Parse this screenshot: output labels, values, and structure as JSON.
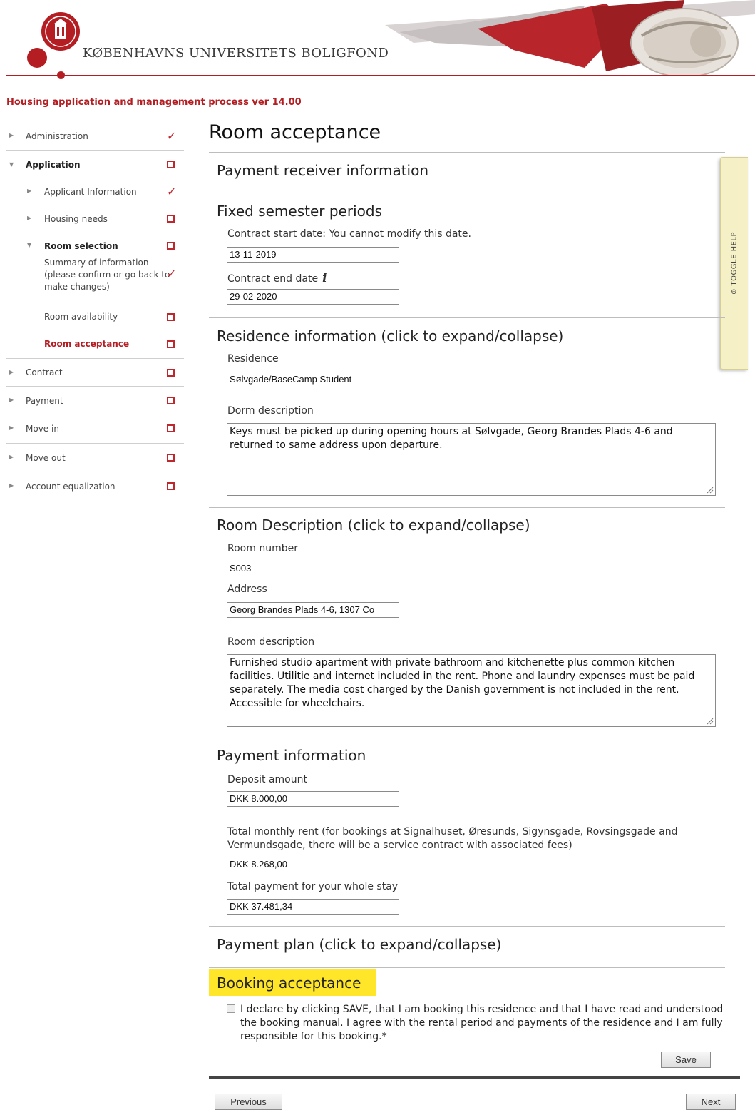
{
  "header": {
    "university_name": "KØBENHAVNS UNIVERSITETS BOLIGFOND",
    "process_title": "Housing application and management process ver 14.00"
  },
  "sidebar": {
    "items": [
      {
        "label": "Administration",
        "status": "check"
      },
      {
        "label": "Application",
        "status": "box"
      },
      {
        "label": "Applicant Information",
        "status": "check"
      },
      {
        "label": "Housing needs",
        "status": "box"
      },
      {
        "label": "Room selection",
        "status": "box"
      },
      {
        "label": "Summary of information (please confirm or go back to make changes)",
        "status": "check"
      },
      {
        "label": "Room availability",
        "status": "box"
      },
      {
        "label": "Room acceptance",
        "status": "box"
      },
      {
        "label": "Contract",
        "status": "box"
      },
      {
        "label": "Payment",
        "status": "box"
      },
      {
        "label": "Move in",
        "status": "box"
      },
      {
        "label": "Move out",
        "status": "box"
      },
      {
        "label": "Account equalization",
        "status": "box"
      }
    ]
  },
  "main": {
    "page_title": "Room acceptance",
    "payment_receiver_title": "Payment receiver information",
    "fixed_periods_title": "Fixed semester periods",
    "contract_start_label": "Contract start date: You cannot modify this date.",
    "contract_start_value": "13-11-2019",
    "contract_end_label": "Contract end date",
    "contract_end_value": "29-02-2020",
    "residence_title": "Residence information (click to expand/collapse)",
    "residence_label": "Residence",
    "residence_value": "Sølvgade/BaseCamp Student",
    "dorm_desc_label": "Dorm description",
    "dorm_desc_value": "Keys must be picked up during opening hours at Sølvgade, Georg Brandes Plads 4-6 and returned to same address upon departure.",
    "room_desc_title": "Room Description (click to expand/collapse)",
    "room_number_label": "Room number",
    "room_number_value": "S003",
    "address_label": "Address",
    "address_value": "Georg Brandes Plads 4-6, 1307 Co",
    "room_description_label": "Room description",
    "room_description_value": "Furnished studio apartment with private bathroom and kitchenette plus common kitchen facilities. Utilitie and internet included in the rent. Phone and laundry expenses must be paid separately. The media cost charged by the Danish government is not included in the rent. Accessible for wheelchairs.",
    "payment_info_title": "Payment information",
    "deposit_label": "Deposit amount",
    "deposit_value": "DKK 8.000,00",
    "monthly_rent_label": "Total monthly rent (for bookings at Signalhuset, Øresunds, Sigynsgade, Rovsingsgade and Vermundsgade, there will be a service contract with associated fees)",
    "monthly_rent_value": "DKK 8.268,00",
    "total_payment_label": "Total payment for your whole stay",
    "total_payment_value": "DKK 37.481,34",
    "payment_plan_title": "Payment plan (click to expand/collapse)",
    "booking_acceptance_title": "Booking acceptance",
    "declaration_text": "I declare by clicking SAVE, that I am booking this residence and that I have read and understood the booking manual. I agree with the rental period and payments of the residence and I am fully responsible for this booking.*",
    "save_label": "Save",
    "previous_label": "Previous",
    "next_label": "Next"
  },
  "toggle_help_label": "⊕ TOGGLE HELP",
  "colors": {
    "brand_red": "#b41e23",
    "highlight_yellow": "#ffe628",
    "help_tab": "#f5f0c6"
  }
}
